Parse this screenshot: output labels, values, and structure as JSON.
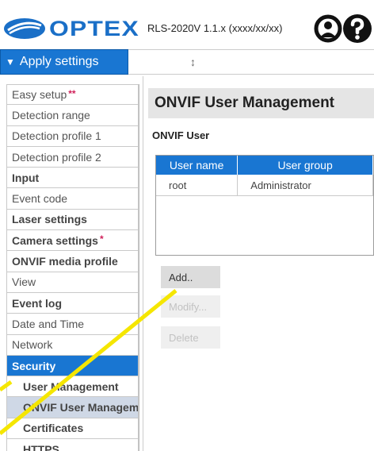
{
  "header": {
    "logo_text": "OPTEX",
    "version": "RLS-2020V 1.1.x (xxxx/xx/xx)",
    "brand_color": "#1a6fc7"
  },
  "apply": {
    "label": "Apply settings",
    "resize_glyph": "↕"
  },
  "sidebar": {
    "accent_color": "#1976d2",
    "items": [
      {
        "label": "Easy setup",
        "star": "**"
      },
      {
        "label": "Detection range"
      },
      {
        "label": "Detection profile 1"
      },
      {
        "label": "Detection profile 2"
      },
      {
        "label": "Input"
      },
      {
        "label": "Event code"
      },
      {
        "label": "Laser settings"
      },
      {
        "label": "Camera settings",
        "star": "*"
      },
      {
        "label": "ONVIF media profile"
      },
      {
        "label": "View"
      },
      {
        "label": "Event log"
      },
      {
        "label": "Date and Time"
      },
      {
        "label": "Network"
      },
      {
        "label": "Security"
      },
      {
        "label": "User Management"
      },
      {
        "label": "ONVIF User Management"
      },
      {
        "label": "Certificates"
      },
      {
        "label": "HTTPS"
      }
    ]
  },
  "main": {
    "title": "ONVIF User Management",
    "section_label": "ONVIF User",
    "table": {
      "headers": [
        "User name",
        "User group"
      ],
      "rows": [
        [
          "root",
          "Administrator"
        ]
      ]
    },
    "buttons": {
      "add": "Add..",
      "modify": "Modify...",
      "delete": "Delete"
    }
  },
  "annotation": {
    "color": "#f5e600"
  }
}
